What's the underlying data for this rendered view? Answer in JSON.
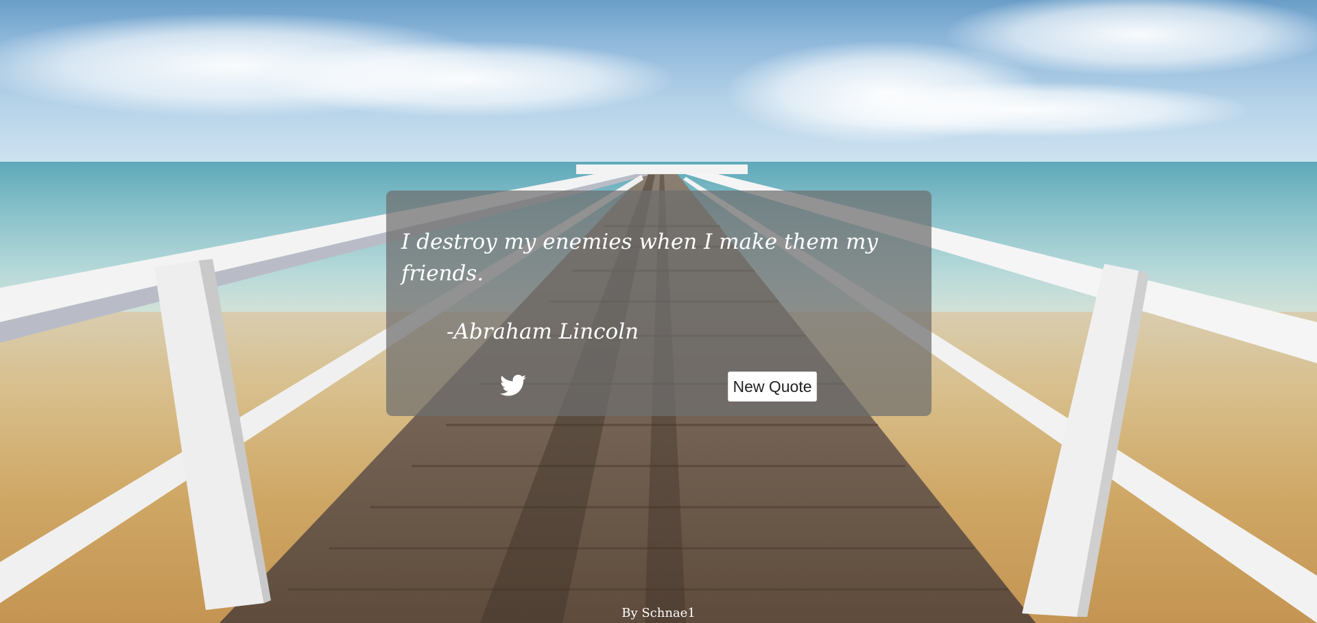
{
  "quote": {
    "text": "I destroy my enemies when I make them my friends.",
    "author": "-Abraham Lincoln"
  },
  "buttons": {
    "tweet_icon": "twitter-bird-icon",
    "new_quote_label": "New Quote"
  },
  "footer": {
    "credit": "By Schnae1"
  },
  "colors": {
    "box_background": "#6e6e6e",
    "text": "#ffffff",
    "button_background": "#ffffff"
  }
}
